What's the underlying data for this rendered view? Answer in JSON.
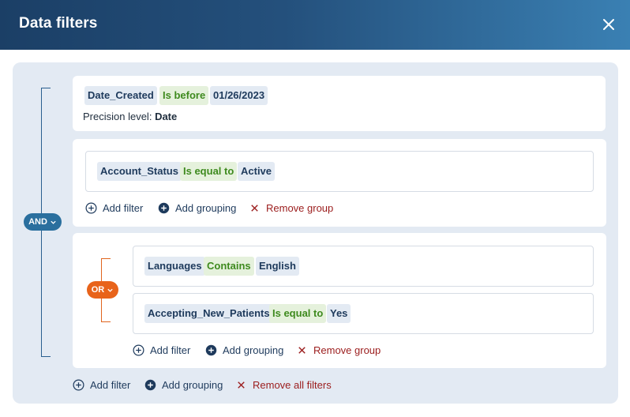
{
  "dialog": {
    "title": "Data filters",
    "close_icon": "close-icon"
  },
  "colors": {
    "header_gradient": [
      "#1b3f66",
      "#3a80b3"
    ],
    "and_pill": "#2a6f9e",
    "or_pill": "#e8631a",
    "operator_text": "#3e8a1e",
    "remove_text": "#9b1c1c"
  },
  "root": {
    "logic": "AND",
    "filter1": {
      "field": "Date_Created",
      "operator": "Is before",
      "value": "01/26/2023",
      "precision_label": "Precision level:",
      "precision_value": "Date"
    },
    "group1": {
      "filter": {
        "field": "Account_Status",
        "operator": "Is equal to",
        "value": "Active"
      },
      "add_filter": "Add filter",
      "add_grouping": "Add grouping",
      "remove_group": "Remove group"
    },
    "group2": {
      "logic": "OR",
      "filter1": {
        "field": "Languages",
        "operator": "Contains",
        "value": "English"
      },
      "filter2": {
        "field": "Accepting_New_Patients",
        "operator": "Is equal to",
        "value": "Yes"
      },
      "add_filter": "Add filter",
      "add_grouping": "Add grouping",
      "remove_group": "Remove group"
    },
    "add_filter": "Add filter",
    "add_grouping": "Add grouping",
    "remove_all": "Remove all filters"
  }
}
